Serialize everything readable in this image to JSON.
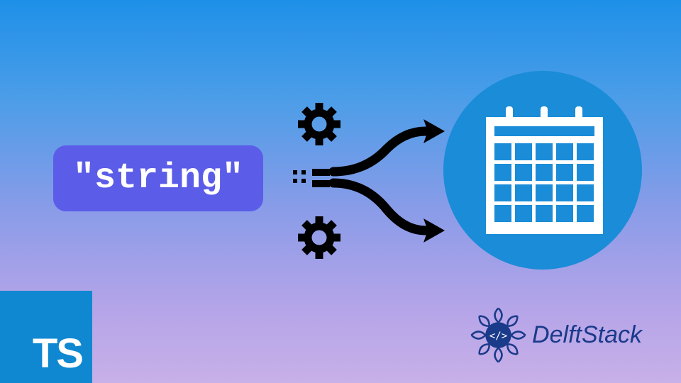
{
  "string_label": "\"string\"",
  "ts_logo": "TS",
  "brand": "DelftStack",
  "colors": {
    "badge": "#5b5de8",
    "circle": "#1a8cd8",
    "ts_bg": "#0f88d1",
    "brand_text": "#1a3a8a"
  }
}
